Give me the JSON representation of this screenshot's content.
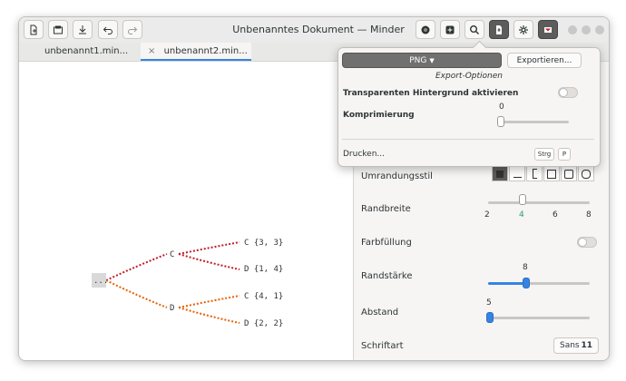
{
  "window": {
    "title": "Unbenanntes Dokument — Minder"
  },
  "tabs": [
    {
      "label": "unbenannt1.min..."
    },
    {
      "label": "unbenannt2.min..."
    }
  ],
  "icons": {
    "new": "new-document-icon",
    "open": "open-file-icon",
    "save": "save-icon",
    "undo": "undo-icon",
    "redo": "redo-icon",
    "record": "record-icon",
    "sticker": "sticker-icon",
    "search": "search-icon",
    "export": "export-icon",
    "settings": "gear-icon",
    "quit": "quit-icon"
  },
  "export_popover": {
    "format": "PNG",
    "export_button": "Exportieren...",
    "section_title": "Export-Optionen",
    "transparent_label": "Transparenten Hintergrund aktivieren",
    "transparent_on": false,
    "compression_label": "Komprimierung",
    "compression_value": "0",
    "print_label": "Drucken...",
    "shortcut_keys": [
      "Strg",
      "P"
    ]
  },
  "sidebar": {
    "border_style_label": "Umrandungsstil",
    "border_width_label": "Randbreite",
    "border_width_ticks": [
      "2",
      "4",
      "6",
      "8"
    ],
    "border_width_value": 4,
    "fill_label": "Farbfüllung",
    "fill_on": false,
    "link_width_label": "Randstärke",
    "link_width_value": "8",
    "padding_label": "Abstand",
    "padding_value": "5",
    "font_label": "Schriftart",
    "font_name": "Sans",
    "font_size": "11"
  },
  "mindmap": {
    "root": "...",
    "nodes": [
      "C",
      "D"
    ],
    "leaves": [
      "C {3, 3}",
      "D {1, 4}",
      "C {4, 1}",
      "D {2, 2}"
    ],
    "colors": {
      "branch1": "#c01c28",
      "branch2": "#e66100",
      "root_bg": "#d9d9d9"
    }
  }
}
